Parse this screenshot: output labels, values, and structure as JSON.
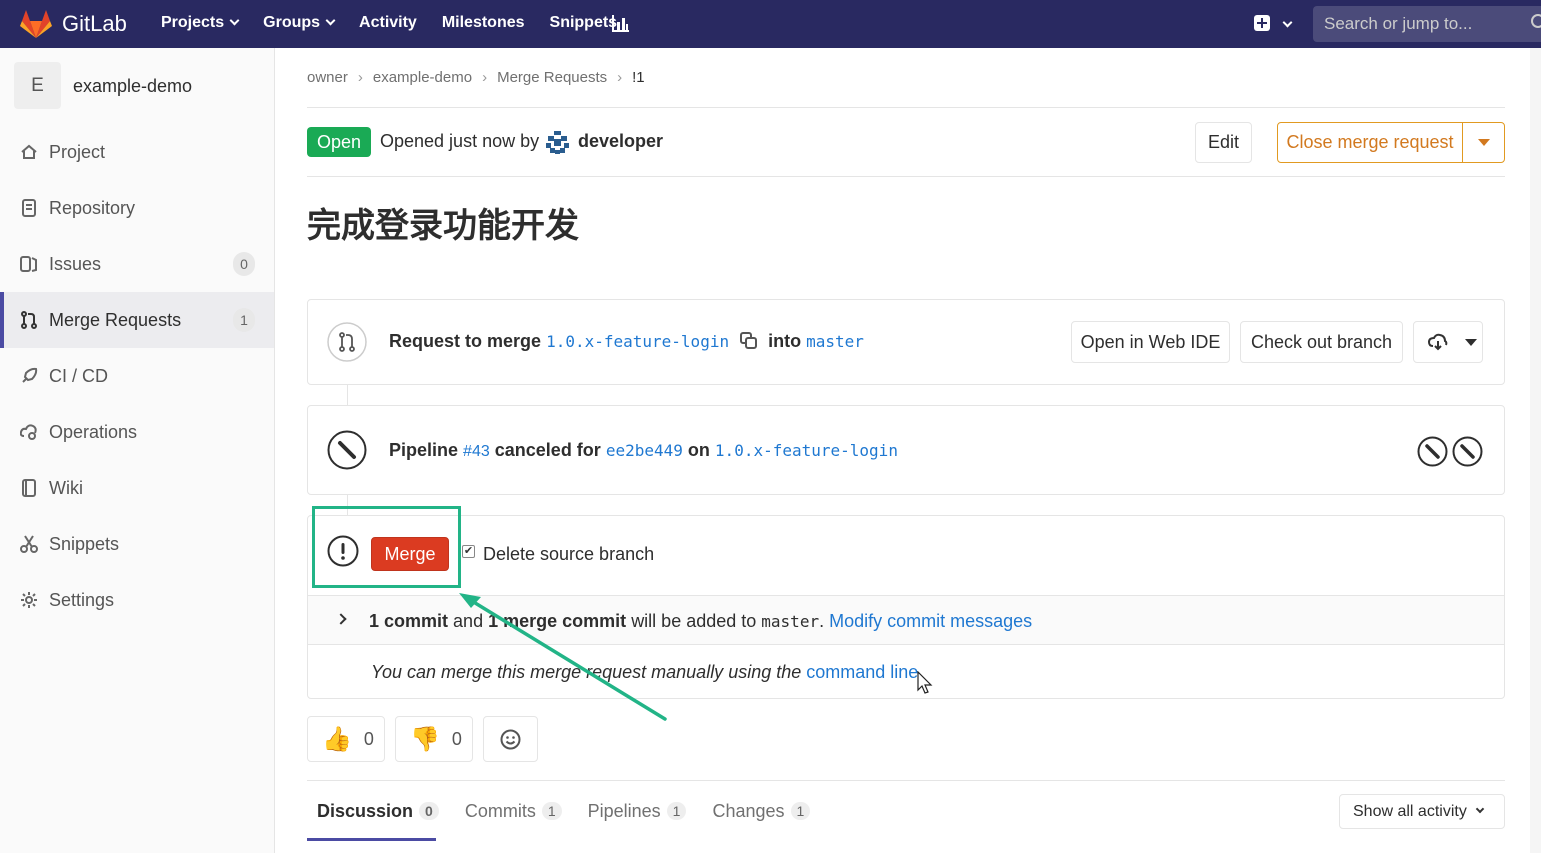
{
  "topnav": {
    "brand": "GitLab",
    "links": [
      "Projects",
      "Groups",
      "Activity",
      "Milestones",
      "Snippets"
    ],
    "search_placeholder": "Search or jump to..."
  },
  "sidebar": {
    "project_initial": "E",
    "project_name": "example-demo",
    "items": [
      {
        "label": "Project",
        "icon": "home-icon"
      },
      {
        "label": "Repository",
        "icon": "doc-icon"
      },
      {
        "label": "Issues",
        "icon": "issues-icon",
        "badge": "0"
      },
      {
        "label": "Merge Requests",
        "icon": "merge-request-icon",
        "badge": "1",
        "active": true
      },
      {
        "label": "CI / CD",
        "icon": "rocket-icon"
      },
      {
        "label": "Operations",
        "icon": "cloud-gear-icon"
      },
      {
        "label": "Wiki",
        "icon": "book-icon"
      },
      {
        "label": "Snippets",
        "icon": "scissors-icon"
      },
      {
        "label": "Settings",
        "icon": "gear-icon"
      }
    ]
  },
  "breadcrumb": [
    "owner",
    "example-demo",
    "Merge Requests",
    "!1"
  ],
  "mr_header": {
    "status": "Open",
    "opened_text": "Opened just now by",
    "author": "developer",
    "edit_label": "Edit",
    "close_label": "Close merge request"
  },
  "mr_title": "完成登录功能开发",
  "merge_info": {
    "request_prefix": "Request to merge",
    "source_branch": "1.0.x-feature-login",
    "into": "into",
    "target_branch": "master",
    "web_ide_label": "Open in Web IDE",
    "checkout_label": "Check out branch"
  },
  "pipeline": {
    "prefix": "Pipeline",
    "id": "#43",
    "status_text": "canceled for",
    "commit": "ee2be449",
    "on": "on",
    "branch": "1.0.x-feature-login"
  },
  "merge_widget": {
    "merge_label": "Merge",
    "delete_source_label": "Delete source branch",
    "delete_source_checked": true,
    "commit_count": "1 commit",
    "and": "and",
    "merge_commit": "1 merge commit",
    "will_be_added": "will be added to",
    "target": "master",
    "period": ".",
    "modify_link": "Modify commit messages",
    "manual_text": "You can merge this merge request manually using the",
    "command_line": "command line"
  },
  "awards": {
    "thumbsup": "0",
    "thumbsdown": "0"
  },
  "tabs": [
    {
      "label": "Discussion",
      "count": "0",
      "active": true
    },
    {
      "label": "Commits",
      "count": "1"
    },
    {
      "label": "Pipelines",
      "count": "1"
    },
    {
      "label": "Changes",
      "count": "1"
    }
  ],
  "activity_filter": "Show all activity",
  "colors": {
    "nav_bg": "#292961",
    "open_green": "#1aaa55",
    "merge_red": "#db3b21",
    "close_orange": "#e19a21",
    "annotation_teal": "#22b487",
    "link_blue": "#1f78d1"
  }
}
